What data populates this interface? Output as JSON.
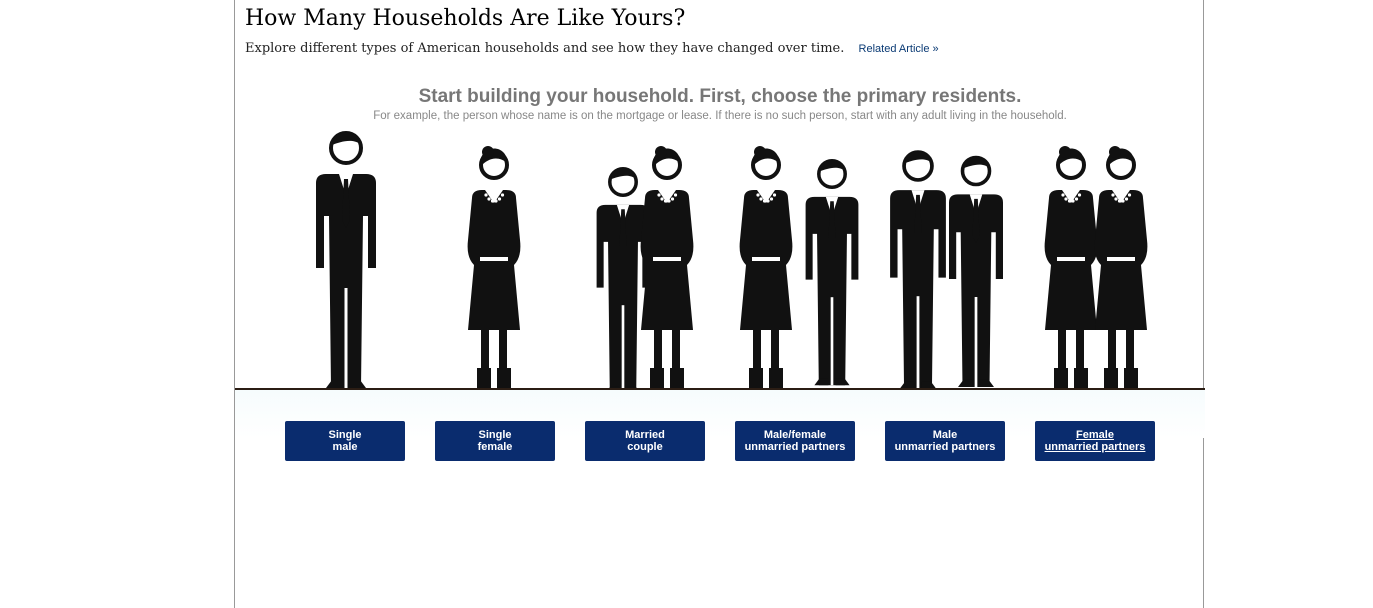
{
  "page": {
    "headline": "How Many Households Are Like Yours?",
    "dek": "Explore different types of American households and see how they have changed over time.",
    "related_link": "Related Article »"
  },
  "builder": {
    "prompt": "Start building your household. First, choose the primary residents.",
    "subprompt": "For example, the person whose name is on the mortgage or lease. If there is no such person, start with any adult living in the household.",
    "options": [
      {
        "line1": "Single",
        "line2": "male"
      },
      {
        "line1": "Single",
        "line2": "female"
      },
      {
        "line1": "Married",
        "line2": "couple"
      },
      {
        "line1": "Male/female",
        "line2": "unmarried partners"
      },
      {
        "line1": "Male",
        "line2": "unmarried partners"
      },
      {
        "line1": "Female",
        "line2": "unmarried partners"
      }
    ],
    "selected_option": "Female unmarried partners"
  },
  "colors": {
    "button": "#0a2c6e",
    "figure": "#111111",
    "prompt": "#777777",
    "link": "#0a3a74"
  },
  "icons": [
    "man-figure-icon",
    "woman-figure-icon"
  ]
}
